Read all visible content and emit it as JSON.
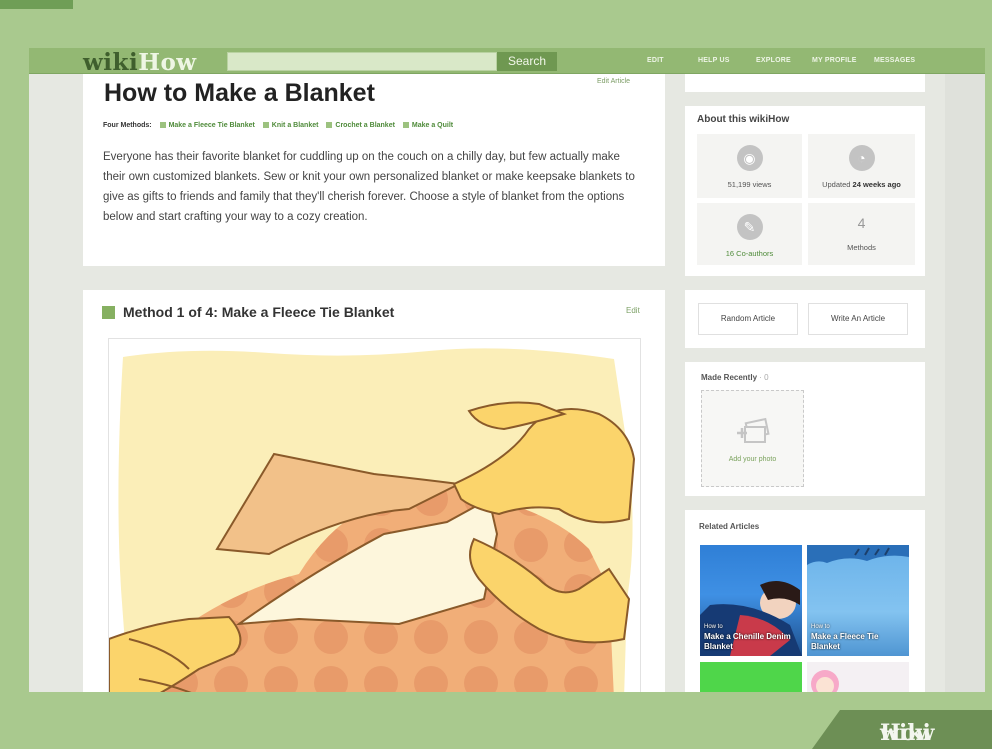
{
  "header": {
    "logo_wiki": "wiki",
    "logo_how": "How",
    "search_label": "Search",
    "nav": [
      "EDIT",
      "HELP US",
      "EXPLORE",
      "MY PROFILE",
      "MESSAGES"
    ]
  },
  "article": {
    "title": "How to Make a Blanket",
    "edit_article": "Edit Article",
    "methods_label": "Four Methods:",
    "methods": [
      "Make a Fleece Tie Blanket",
      "Knit a Blanket",
      "Crochet a Blanket",
      "Make a Quilt"
    ],
    "intro": "Everyone has their favorite blanket for cuddling up on the couch on a chilly day, but few actually make their own customized blankets. Sew or knit your own personalized blanket or make keepsake blankets to give as gifts to friends and family that they'll cherish forever. Choose a style of blanket from the options below and start crafting your way to a cozy creation.",
    "method_heading": "Method 1 of 4: Make a Fleece Tie Blanket",
    "method_edit": "Edit"
  },
  "sidebar": {
    "about_title": "About this wikiHow",
    "views": "51,199 views",
    "updated_prefix": "Updated ",
    "updated_value": "24 weeks ago",
    "coauthors": "16 Co-authors",
    "methods_count": "4",
    "methods_label": "Methods",
    "random_article": "Random Article",
    "write_article": "Write An Article",
    "made_recently": "Made Recently",
    "made_recently_count": " · 0",
    "add_photo": "Add your photo",
    "related_title": "Related Articles",
    "related": [
      {
        "small": "How to",
        "title": "Make a Chenille Denim Blanket"
      },
      {
        "small": "How to",
        "title": "Make a Fleece Tie Blanket"
      }
    ]
  },
  "watermark": {
    "wiki": "wiki",
    "how": "How"
  },
  "colors": {
    "accent_green": "#93b873",
    "background": "#a9c98e",
    "link_green": "#4f8b3a"
  }
}
